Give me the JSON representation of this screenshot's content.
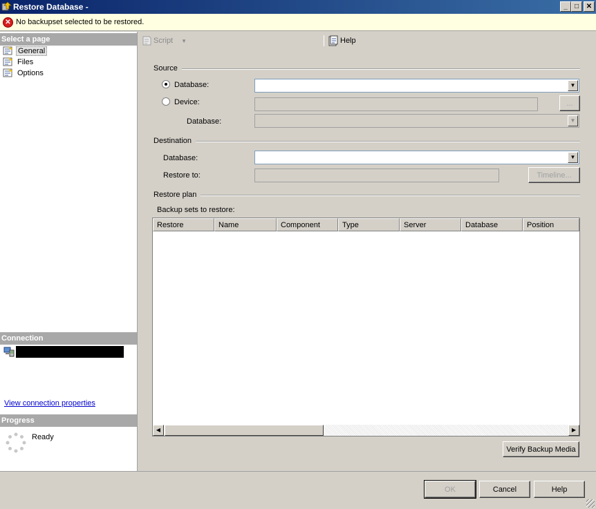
{
  "window": {
    "title": "Restore Database -",
    "controls": {
      "minimize": "_",
      "maximize": "□",
      "close": "✕"
    }
  },
  "error": {
    "icon": "error-icon",
    "message": "No backupset selected to be restored."
  },
  "left": {
    "select_page_header": "Select a page",
    "pages": [
      {
        "label": "General",
        "selected": true
      },
      {
        "label": "Files",
        "selected": false
      },
      {
        "label": "Options",
        "selected": false
      }
    ],
    "connection_header": "Connection",
    "connection_link": "View connection properties",
    "progress_header": "Progress",
    "progress_status": "Ready"
  },
  "toolbar": {
    "script_label": "Script",
    "help_label": "Help"
  },
  "source": {
    "group_label": "Source",
    "database_radio_label": "Database:",
    "device_radio_label": "Device:",
    "device_database_label": "Database:",
    "browse_label": "...",
    "database_value": "",
    "device_value": "",
    "device_database_value": ""
  },
  "destination": {
    "group_label": "Destination",
    "database_label": "Database:",
    "restore_to_label": "Restore to:",
    "timeline_label": "Timeline...",
    "database_value": "",
    "restore_to_value": ""
  },
  "restore_plan": {
    "group_label": "Restore plan",
    "backup_sets_label": "Backup sets to restore:",
    "columns": [
      "Restore",
      "Name",
      "Component",
      "Type",
      "Server",
      "Database",
      "Position"
    ],
    "rows": [],
    "verify_label": "Verify Backup Media"
  },
  "buttons": {
    "ok": "OK",
    "cancel": "Cancel",
    "help": "Help"
  }
}
